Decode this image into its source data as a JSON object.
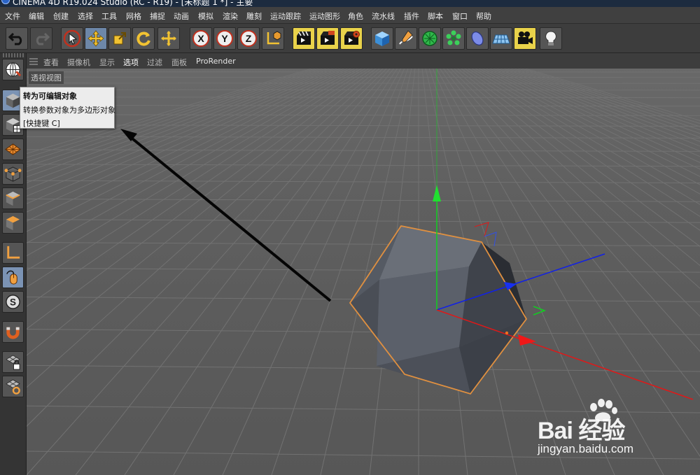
{
  "titlebar": {
    "title": "CINEMA 4D R19.024 Studio (RC - R19) - [未标题 1 *] - 主要"
  },
  "menu": [
    "文件",
    "编辑",
    "创建",
    "选择",
    "工具",
    "网格",
    "捕捉",
    "动画",
    "模拟",
    "渲染",
    "雕刻",
    "运动跟踪",
    "运动图形",
    "角色",
    "流水线",
    "插件",
    "脚本",
    "窗口",
    "帮助"
  ],
  "toolbar": {
    "icons": [
      "undo-icon",
      "redo-icon",
      "live-select-icon",
      "move-icon",
      "scale-icon",
      "rotate-icon",
      "recent-tool-icon",
      "x-axis-icon",
      "y-axis-icon",
      "z-axis-icon",
      "world-coordinates-icon",
      "render-view-icon",
      "render-picture-viewer-icon",
      "render-settings-icon",
      "cube-icon",
      "pen-icon",
      "subdivision-icon",
      "cloner-icon",
      "deformer-icon",
      "floor-icon",
      "camera-icon",
      "light-icon"
    ],
    "x_label": "X",
    "y_label": "Y",
    "z_label": "Z"
  },
  "viewport": {
    "menu": [
      "查看",
      "摄像机",
      "显示",
      "选项",
      "过滤",
      "面板",
      "ProRender"
    ],
    "active_menu": "选项",
    "label": "透视视图"
  },
  "tooltip": {
    "title": "转为可编辑对象",
    "description": "转换参数对象为多边形对象",
    "shortcut": "[快捷键 C]"
  },
  "watermark": {
    "brand": "Bai 经验",
    "site": "jingyan.baidu.com"
  },
  "colors": {
    "axis_x": "#e01818",
    "axis_y": "#10d020",
    "axis_z": "#1020e8",
    "selection_outline": "#e09040",
    "viewport_bg": "#5c5c5c",
    "tool_highlight": "#e9d24a"
  }
}
